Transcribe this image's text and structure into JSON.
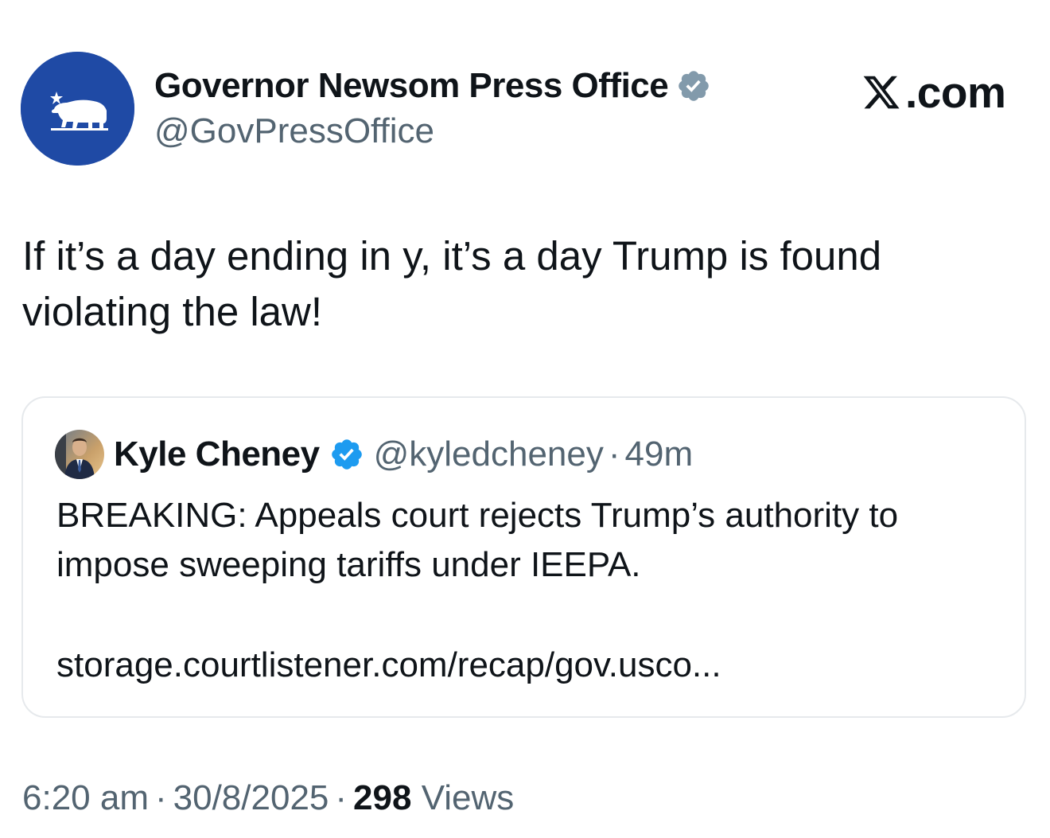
{
  "author": {
    "display_name": "Governor Newsom Press Office",
    "handle": "@GovPressOffice",
    "verified_badge": "gray-verified-badge-icon",
    "avatar_icon": "california-bear-flag-icon",
    "avatar_color": "#1f4aa5"
  },
  "brand": {
    "label": ".com",
    "icon": "x-logo-icon"
  },
  "tweet": {
    "text": "If it’s a day ending in y, it’s a day Trump is found violating the law!"
  },
  "quote": {
    "display_name": "Kyle Cheney",
    "handle": "@kyledcheney",
    "separator": "·",
    "time": "49m",
    "verified_badge": "blue-verified-badge-icon",
    "text": "BREAKING: Appeals court rejects Trump’s authority to impose sweeping tariffs under IEEPA.",
    "link": "storage.courtlistener.com/recap/gov.usco..."
  },
  "meta": {
    "time": "6:20 am",
    "separator": "·",
    "date": "30/8/2025",
    "views_count": "298",
    "views_label": "Views"
  },
  "colors": {
    "text_primary": "#0f1419",
    "text_secondary": "#536471",
    "verified_blue": "#1d9bf0",
    "verified_gray": "#829aab",
    "card_border": "#e6e9ec"
  }
}
